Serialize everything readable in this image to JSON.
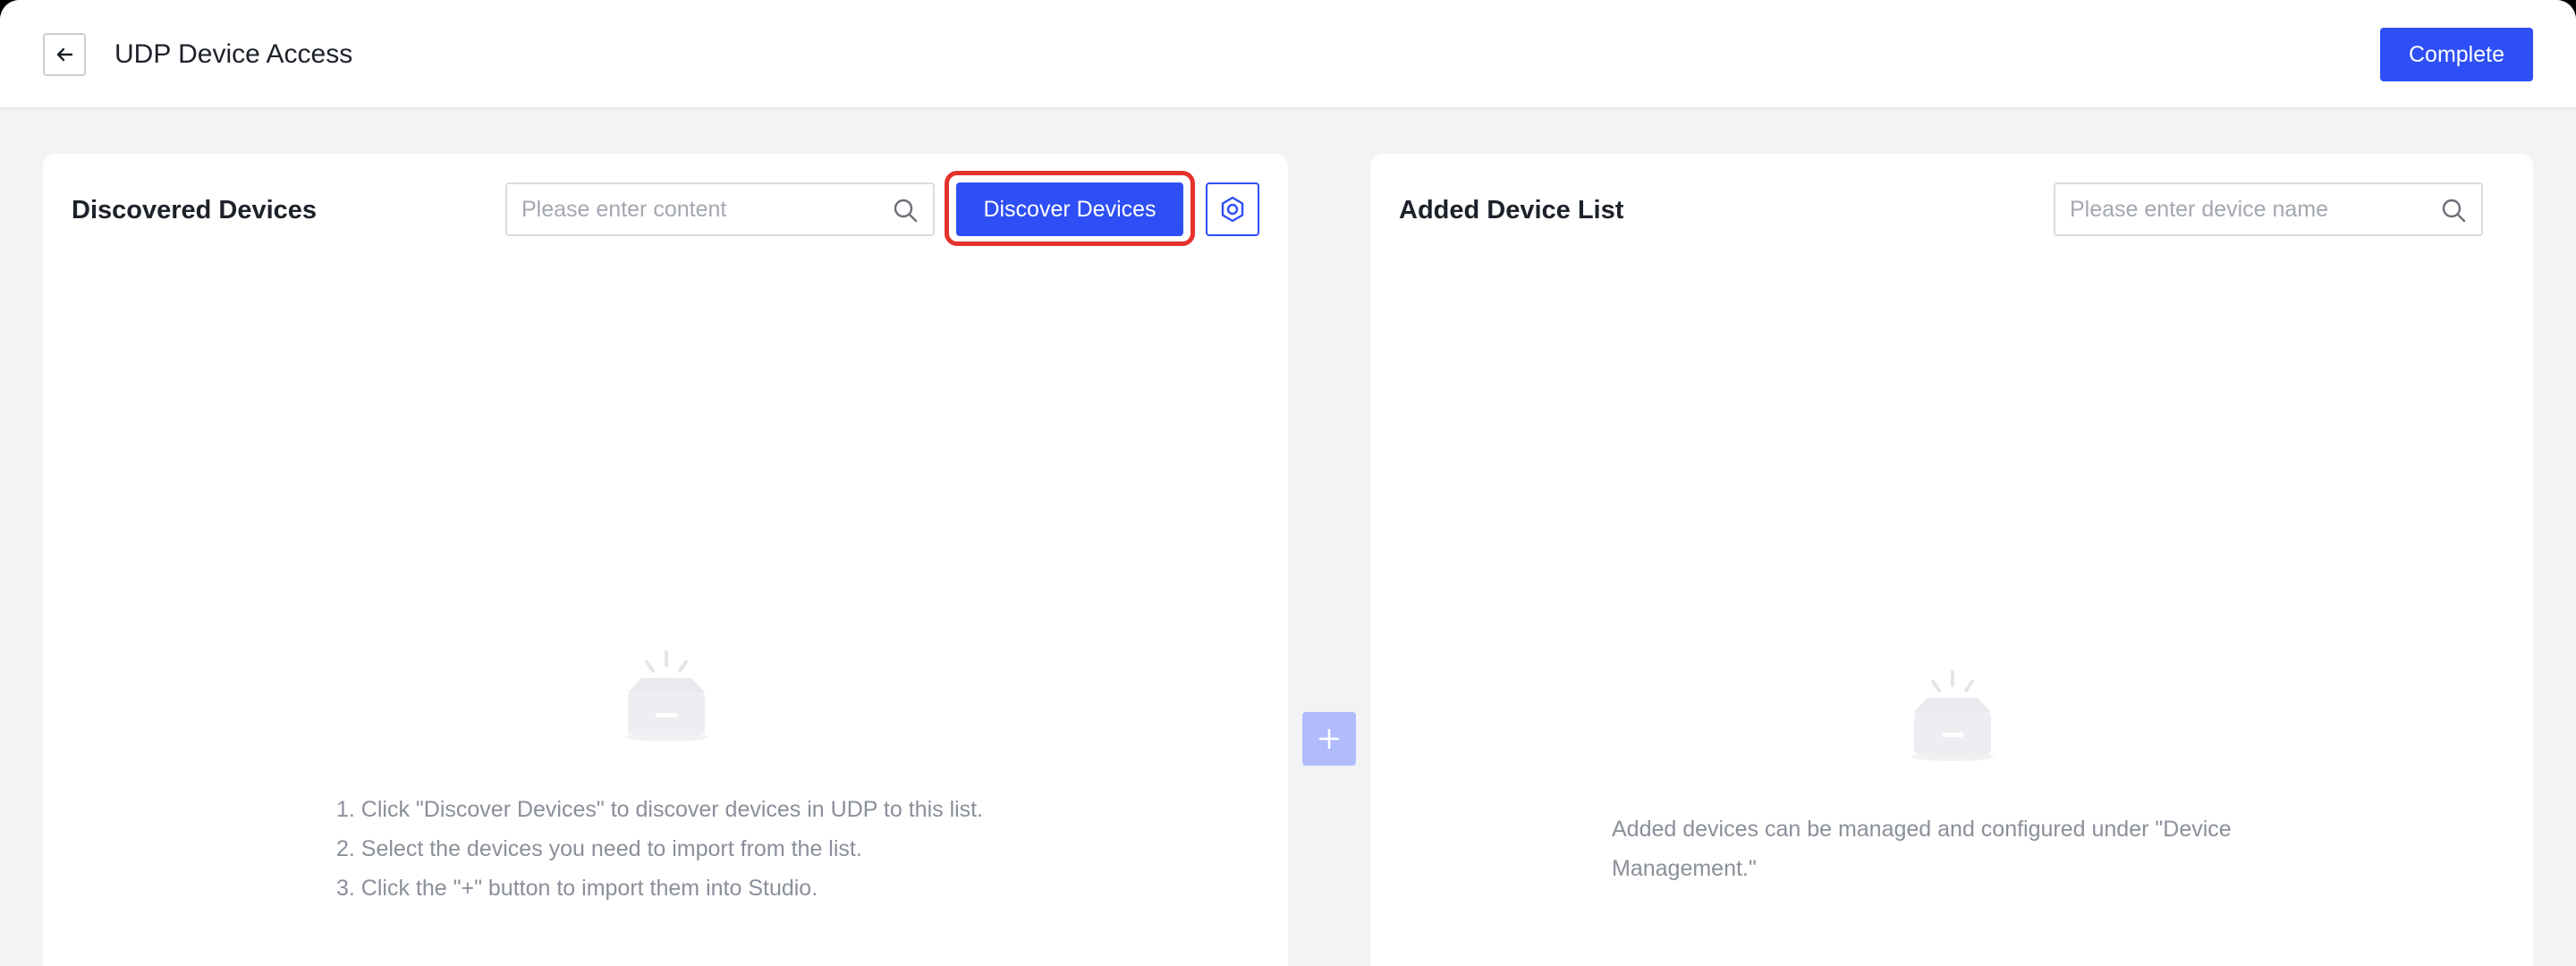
{
  "header": {
    "title": "UDP Device Access",
    "complete_label": "Complete"
  },
  "discovered": {
    "title": "Discovered Devices",
    "search_placeholder": "Please enter content",
    "discover_label": "Discover Devices",
    "hints": [
      "1. Click \"Discover Devices\" to discover devices in UDP to this list.",
      "2. Select the devices you need to import from the list.",
      "3. Click the \"+\" button to import them into Studio."
    ]
  },
  "added": {
    "title": "Added Device List",
    "search_placeholder": "Please enter device name",
    "empty_lines": [
      "Added devices can be managed and configured under \"Device",
      "Management.\""
    ]
  },
  "icons": {
    "back": "arrow-left-icon",
    "search": "search-icon",
    "settings": "settings-hexagon-icon",
    "add": "plus-icon",
    "empty": "empty-box-icon"
  },
  "colors": {
    "primary": "#2e4ff5",
    "primary_disabled": "#b0bcfb",
    "highlight": "#e5322d",
    "background": "#f2f3f5"
  }
}
